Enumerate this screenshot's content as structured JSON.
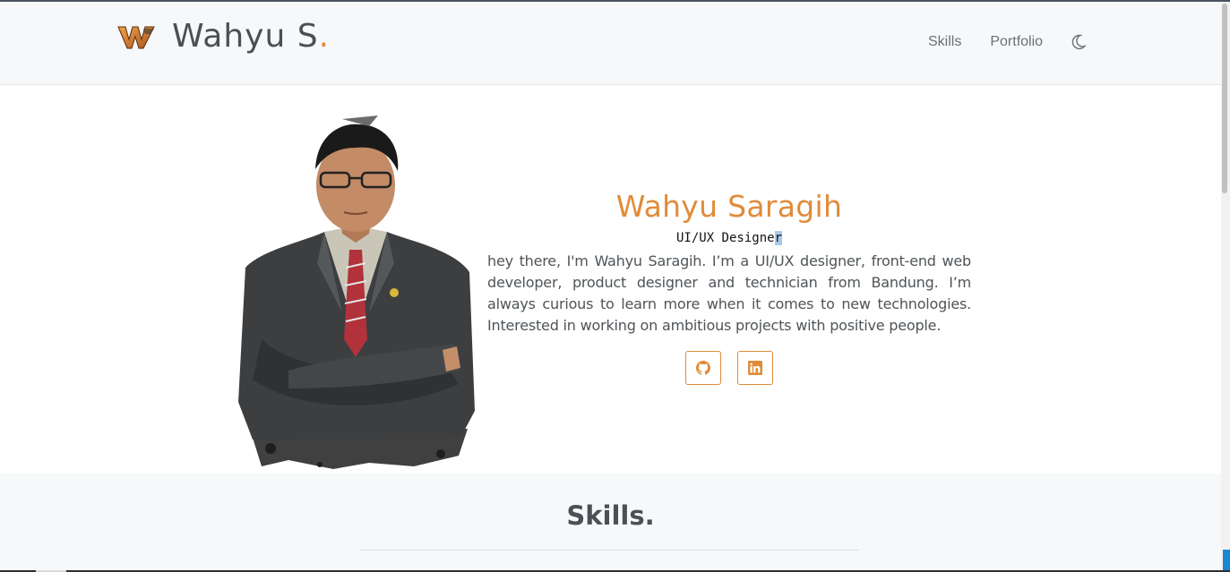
{
  "header": {
    "brand_name": "Wahyu S",
    "brand_dot": ".",
    "brand_logo_text": "WS",
    "nav": [
      "Skills",
      "Portfolio"
    ],
    "theme_toggle_icon": "moon-icon",
    "accent_color": "#e08b3a"
  },
  "hero": {
    "name": "Wahyu Saragih",
    "role_main": "UI/UX Designe",
    "role_caret": "r",
    "bio": "hey there, I'm Wahyu Saragih. I’m a UI/UX designer, front-end web developer, product designer and technician from Bandung. I’m always curious to learn more when it comes to new technologies. Interested in working on ambitious projects with positive people.",
    "social": [
      {
        "icon": "github-icon"
      },
      {
        "icon": "linkedin-icon"
      }
    ]
  },
  "skills": {
    "title": "Skills."
  }
}
